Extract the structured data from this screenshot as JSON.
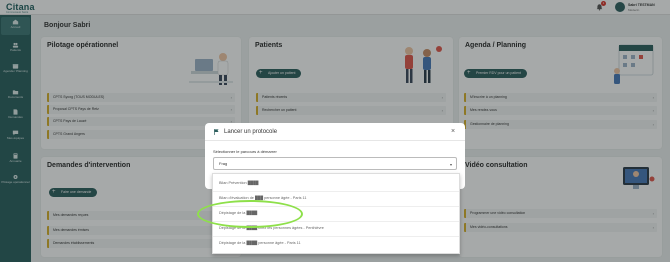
{
  "app": {
    "logo": "Citana",
    "logo_sub": "Communauté Santé"
  },
  "header": {
    "notifications_count": "1",
    "user_name": "Sabri TESTMAN",
    "user_role": "Médecin"
  },
  "sidebar": {
    "items": [
      {
        "label": "Accueil",
        "icon": "home-icon",
        "active": true
      },
      {
        "label": "Patients",
        "icon": "users-icon"
      },
      {
        "label": "Agenda / Planning",
        "icon": "calendar-icon"
      },
      {
        "label": "Documents",
        "icon": "folder-icon"
      },
      {
        "label": "Demandes",
        "icon": "file-icon"
      },
      {
        "label": "Mes équipes",
        "icon": "chat-icon"
      },
      {
        "label": "Annuaire",
        "icon": "book-icon"
      },
      {
        "label": "Pilotage opérationnel",
        "icon": "gear-icon"
      }
    ]
  },
  "greeting": "Bonjour Sabri",
  "pilotage": {
    "title": "Pilotage opérationnel",
    "rows": [
      "CPTS Syoxg (TOUS MODULES)",
      "Proposal CPTS Pays de Retz",
      "CPTS Pays de Lauzé",
      "CPTS Grand Angers"
    ]
  },
  "patients": {
    "title": "Patients",
    "button": "Ajouter un patient",
    "rows": [
      "Patients récents",
      "Rechercher un patient"
    ]
  },
  "agenda": {
    "title": "Agenda / Planning",
    "button": "Premier RDV pour un patient",
    "rows": [
      "M'inscrire à un planning",
      "Mes rendez-vous",
      "Gestionnaire de planning"
    ]
  },
  "demandes": {
    "title": "Demandes d'intervention",
    "button": "Faire une demande",
    "rows": [
      "Mes demandes reçues",
      "Mes demandes émises",
      "Demandes établissements"
    ]
  },
  "video": {
    "title": "Vidéo consultation",
    "rows": [
      "Programmer une vidéo consultation",
      "Mes vidéo-consultations"
    ]
  },
  "modal": {
    "title": "Lancer un protocole",
    "field_label": "Sélectionner le parcours à démarrer",
    "search_value": "Frag",
    "options": [
      "Bilan Prévention ████",
      "Bilan d'évaluation de ███ personne âgée - Paris 11",
      "Dépistage de la ████",
      "Dépistage de la ████ chez les personnes âgées - Penthièvre",
      "Dépistage de la ████ personne âgée - Paris 11"
    ]
  },
  "colors": {
    "sidebar": "#2a5f5e",
    "accent": "#2e5f5e",
    "row_border": "#d9b02a",
    "highlight": "#8ee04a"
  }
}
